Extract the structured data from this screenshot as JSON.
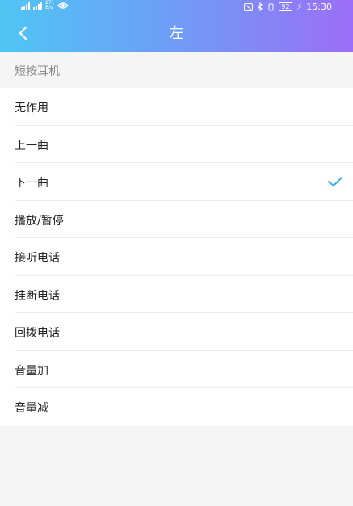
{
  "status_bar": {
    "network_speed_value": "271",
    "network_speed_unit": "B/s",
    "battery": "92",
    "time": "15:30"
  },
  "header": {
    "title": "左"
  },
  "section": {
    "title": "短按耳机"
  },
  "options": [
    {
      "label": "无作用",
      "selected": false
    },
    {
      "label": "上一曲",
      "selected": false
    },
    {
      "label": "下一曲",
      "selected": true
    },
    {
      "label": "播放/暂停",
      "selected": false
    },
    {
      "label": "接听电话",
      "selected": false
    },
    {
      "label": "挂断电话",
      "selected": false
    },
    {
      "label": "回拨电话",
      "selected": false
    },
    {
      "label": "音量加",
      "selected": false
    },
    {
      "label": "音量减",
      "selected": false
    }
  ],
  "colors": {
    "check": "#3fa9f5",
    "gradient_start": "#4fc6f5",
    "gradient_end": "#9b6ef7"
  }
}
